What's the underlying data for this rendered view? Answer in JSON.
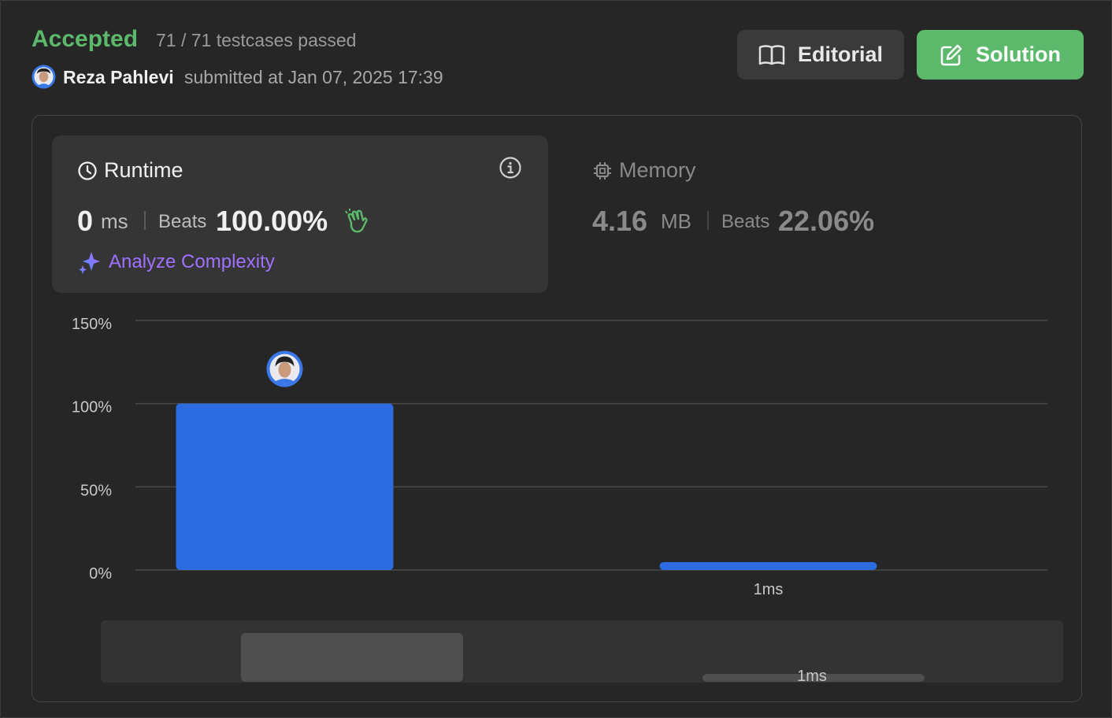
{
  "header": {
    "status": "Accepted",
    "testcases": "71 / 71 testcases passed",
    "user_name": "Reza Pahlevi",
    "submitted_text": "submitted at Jan 07, 2025 17:39",
    "editorial_label": "Editorial",
    "solution_label": "Solution"
  },
  "runtime": {
    "title": "Runtime",
    "value": "0",
    "unit": "ms",
    "beats_label": "Beats",
    "beats_value": "100.00%",
    "analyze_label": "Analyze Complexity"
  },
  "memory": {
    "title": "Memory",
    "value": "4.16",
    "unit": "MB",
    "beats_label": "Beats",
    "beats_value": "22.06%"
  },
  "colors": {
    "accent_green": "#5cb96b",
    "bar_blue": "#2d6be0",
    "purple": "#a070ff"
  },
  "icons": [
    "clock-icon",
    "chip-icon",
    "book-icon",
    "edit-icon",
    "info-icon",
    "sparkle-icon",
    "clap-icon",
    "avatar"
  ],
  "chart_data": {
    "type": "bar",
    "yticks": [
      "150%",
      "100%",
      "50%",
      "0%"
    ],
    "ylim": [
      0,
      150
    ],
    "categories": [
      "",
      "1ms"
    ],
    "values": [
      100,
      0.9
    ],
    "minimap_label": "1ms"
  }
}
